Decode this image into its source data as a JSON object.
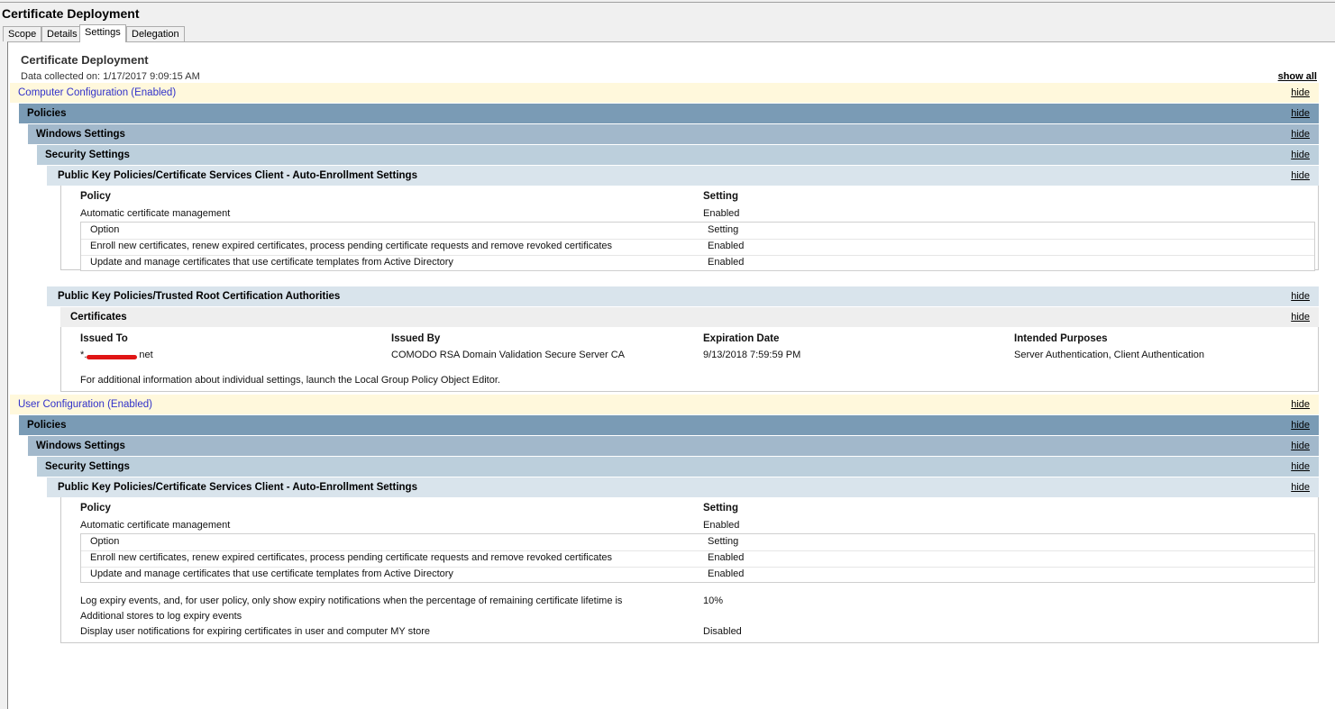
{
  "window_title": "Certificate Deployment",
  "tabs": [
    "Scope",
    "Details",
    "Settings",
    "Delegation"
  ],
  "active_tab": "Settings",
  "report": {
    "title": "Certificate Deployment",
    "data_collected": "Data collected on: 1/17/2017 9:09:15 AM",
    "show_all": "show all",
    "hide_label": "hide"
  },
  "computer": {
    "header": "Computer Configuration (Enabled)",
    "policies": "Policies",
    "windows_settings": "Windows Settings",
    "security_settings": "Security Settings",
    "autoenroll": {
      "header": "Public Key Policies/Certificate Services Client - Auto-Enrollment Settings",
      "col_policy": "Policy",
      "col_setting": "Setting",
      "policy_name": "Automatic certificate management",
      "policy_value": "Enabled",
      "options": [
        {
          "option": "Option",
          "setting": "Setting"
        },
        {
          "option": "Enroll new certificates, renew expired certificates, process pending certificate requests and remove revoked certificates",
          "setting": "Enabled"
        },
        {
          "option": "Update and manage certificates that use certificate templates from Active Directory",
          "setting": "Enabled"
        }
      ]
    },
    "trusted_root": {
      "header": "Public Key Policies/Trusted Root Certification Authorities",
      "certificates": "Certificates",
      "columns": [
        "Issued To",
        "Issued By",
        "Expiration Date",
        "Intended Purposes"
      ],
      "rows": [
        {
          "issued_to_prefix": "*.",
          "issued_to_suffix": "net",
          "issued_by": "COMODO RSA Domain Validation Secure Server CA",
          "expiration": "9/13/2018 7:59:59 PM",
          "purposes": "Server Authentication, Client Authentication"
        }
      ],
      "note": "For additional information about individual settings, launch the Local Group Policy Object Editor."
    }
  },
  "user": {
    "header": "User Configuration (Enabled)",
    "policies": "Policies",
    "windows_settings": "Windows Settings",
    "security_settings": "Security Settings",
    "autoenroll": {
      "header": "Public Key Policies/Certificate Services Client - Auto-Enrollment Settings",
      "col_policy": "Policy",
      "col_setting": "Setting",
      "policy_name": "Automatic certificate management",
      "policy_value": "Enabled",
      "options": [
        {
          "option": "Option",
          "setting": "Setting"
        },
        {
          "option": "Enroll new certificates, renew expired certificates, process pending certificate requests and remove revoked certificates",
          "setting": "Enabled"
        },
        {
          "option": "Update and manage certificates that use certificate templates from Active Directory",
          "setting": "Enabled"
        }
      ],
      "extra": [
        {
          "label": "Log expiry events, and, for user policy, only show expiry notifications when the percentage of remaining certificate lifetime is",
          "value": "10%"
        },
        {
          "label": "Additional stores to log expiry events",
          "value": ""
        },
        {
          "label": "Display user notifications for expiring certificates in user and computer MY store",
          "value": "Disabled"
        }
      ]
    }
  },
  "colors": {
    "config_header_bg": "#fff8dc",
    "config_header_text": "#3131c9",
    "policies_bg": "#7a9bb5",
    "windows_bg": "#a2b8cb",
    "security_bg": "#bccfdc",
    "category_bg": "#d9e4ec"
  }
}
